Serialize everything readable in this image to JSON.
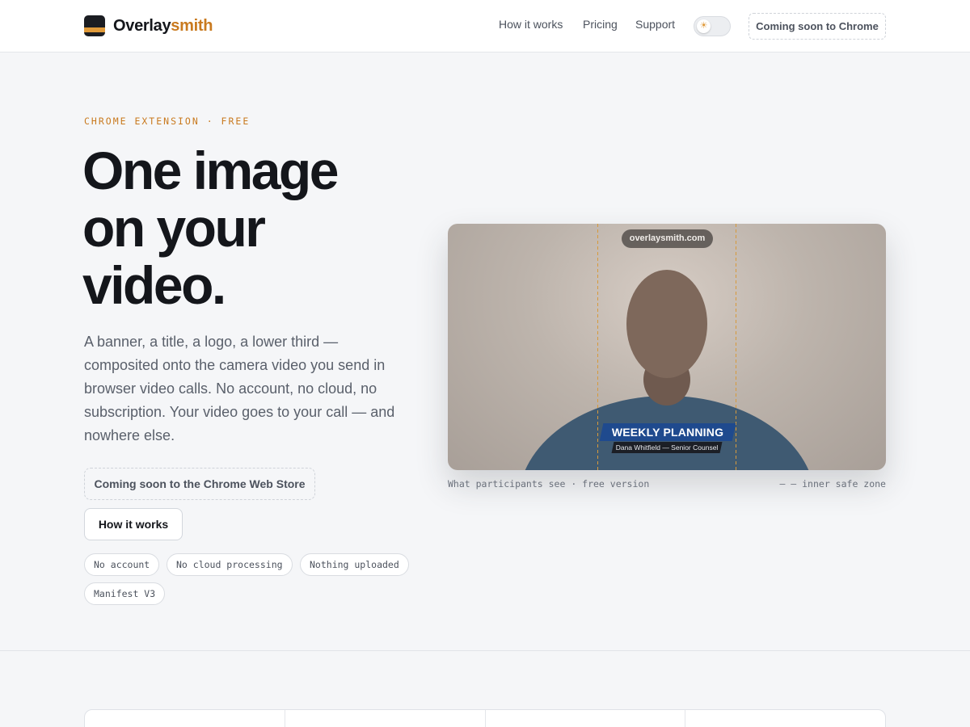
{
  "header": {
    "brand_main": "Overlay",
    "brand_accent": "smith",
    "logo_icon": "overlay-logo-icon",
    "nav": [
      "How it works",
      "Pricing",
      "Support"
    ],
    "theme_toggle_icon": "sun-icon",
    "cta_label": "Coming soon to Chrome"
  },
  "hero": {
    "eyebrow": "CHROME EXTENSION · FREE",
    "title_lines": [
      "One image",
      "on your",
      "video."
    ],
    "description": "A banner, a title, a logo, a lower third — composited onto the camera video you send in browser video calls. No account, no cloud, no subscription. Your video goes to your call — and nowhere else.",
    "store_button": "Coming soon to the Chrome Web Store",
    "how_button": "How it works",
    "chips": [
      "No account",
      "No cloud processing",
      "Nothing uploaded",
      "Manifest V3"
    ]
  },
  "preview": {
    "url_badge": "overlaysmith.com",
    "lower_third_title": "WEEKLY PLANNING",
    "lower_third_subtitle": "Dana Whitfield — Senior Counsel",
    "caption_left": "What participants see · free version",
    "caption_right": "– – inner safe zone"
  },
  "colors": {
    "accent": "#c97a1f",
    "lower_third_blue": "#1f4a8e",
    "text_dark": "#14161b"
  }
}
